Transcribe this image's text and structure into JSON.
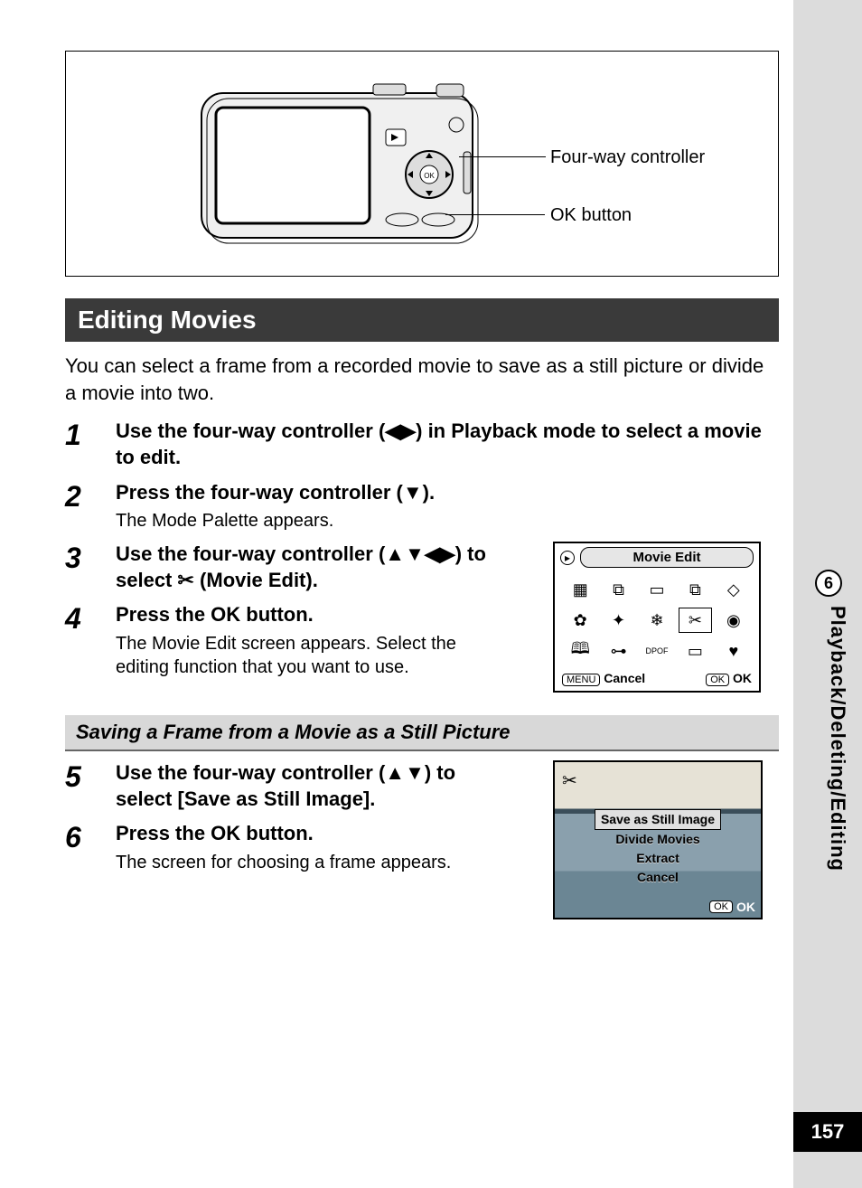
{
  "diagram": {
    "label_fourway": "Four-way controller",
    "label_ok": "OK button"
  },
  "section_title": "Editing Movies",
  "intro": "You can select a frame from a recorded movie to save as a still picture or divide a movie into two.",
  "steps": {
    "s1": {
      "num": "1",
      "title_a": "Use the four-way controller (",
      "title_b": ") in Playback mode to select a movie to edit."
    },
    "s2": {
      "num": "2",
      "title_a": "Press the four-way controller (",
      "title_b": ").",
      "desc": "The Mode Palette appears."
    },
    "s3": {
      "num": "3",
      "title_a": "Use the four-way controller (",
      "title_b": ") to select ",
      "title_c": " (Movie Edit)."
    },
    "s4": {
      "num": "4",
      "title": "Press the OK button.",
      "desc": "The Movie Edit screen appears. Select the editing function that you want to use."
    },
    "s5": {
      "num": "5",
      "title_a": "Use the four-way controller (",
      "title_b": ") to select [Save as Still Image]."
    },
    "s6": {
      "num": "6",
      "title": "Press the OK button.",
      "desc": "The screen for choosing a frame appears."
    }
  },
  "sub_header": "Saving a Frame from a Movie as a Still Picture",
  "palette": {
    "title": "Movie Edit",
    "menu_btn": "MENU",
    "cancel": "Cancel",
    "ok_btn": "OK",
    "ok": "OK"
  },
  "review": {
    "opt1": "Save as Still Image",
    "opt2": "Divide Movies",
    "opt3": "Extract",
    "opt4": "Cancel",
    "ok_btn": "OK",
    "ok": "OK"
  },
  "sidebar": {
    "chapter_num": "6",
    "chapter_label": "Playback/Deleting/Editing"
  },
  "page_number": "157",
  "glyphs": {
    "left": "◀",
    "right": "▶",
    "up": "▲",
    "down": "▼",
    "scissors": "✂",
    "play_box": "▸"
  }
}
